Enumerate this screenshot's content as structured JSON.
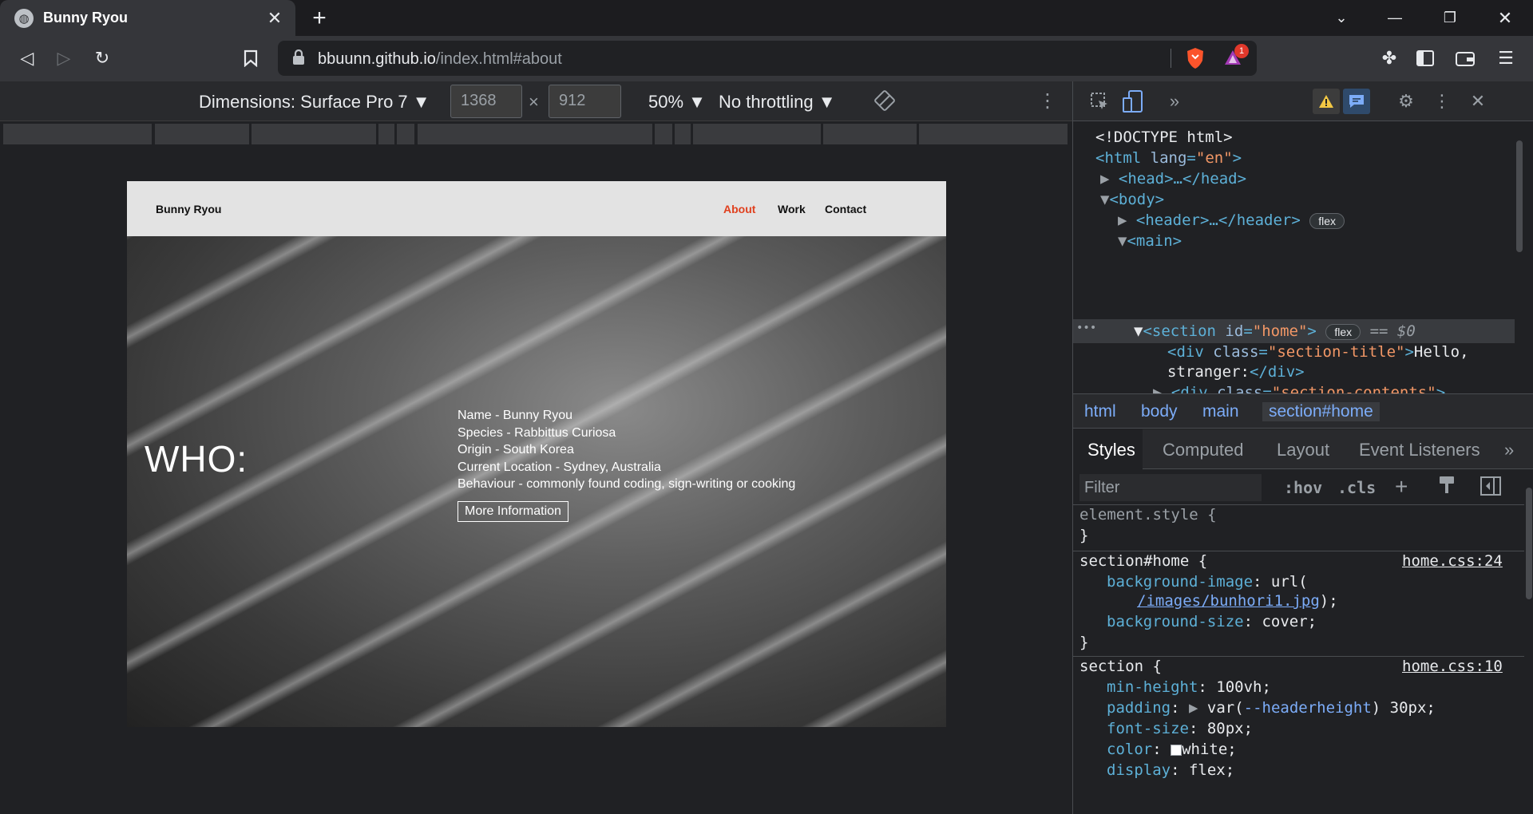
{
  "browser": {
    "tab_title": "Bunny Ryou",
    "url_host": "bbuunn.github.io",
    "url_path": "/index.html#about",
    "brave_badge": "1"
  },
  "device_toolbar": {
    "dimensions": "Dimensions: Surface Pro 7 ▼",
    "width": "1368",
    "times": "×",
    "height": "912",
    "zoom": "50% ▼",
    "throttling": "No throttling ▼"
  },
  "site": {
    "logo": "Bunny Ryou",
    "nav": [
      {
        "label": "About",
        "color": "#e0401e"
      },
      {
        "label": "Work",
        "color": "#111111"
      },
      {
        "label": "Contact",
        "color": "#111111"
      }
    ],
    "section_title": "WHO:",
    "info": [
      "Name - Bunny Ryou",
      "Species - Rabbittus Curiosa",
      "Origin - South Korea",
      "Current Location - Sydney, Australia",
      "Behaviour - commonly found coding, sign-writing or cooking"
    ],
    "more_button": "More Information"
  },
  "devtools": {
    "elements": {
      "doctype": "<!DOCTYPE html>",
      "html_open": "<html",
      "lang_attr": "lang",
      "lang_val": "\"en\"",
      "head": "<head>…</head>",
      "body": "<body>",
      "header": "<header>…</header>",
      "main": "<main>",
      "section_open": "<section",
      "id_attr": "id",
      "id_val": "\"home\"",
      "flex_badge": "flex",
      "eq_dollar": "== $0",
      "div_open": "<div",
      "class_attr": "class",
      "class_title": "\"section-title\"",
      "div_text": "Hello,",
      "div_text2": "stranger:",
      "div_close": "</div>",
      "class_contents": "\"section-contents\"",
      "ellipsis": ">…",
      "dots": "•••"
    },
    "breadcrumbs": [
      "html",
      "body",
      "main",
      "section#home"
    ],
    "style_tabs": [
      "Styles",
      "Computed",
      "Layout",
      "Event Listeners"
    ],
    "filter_placeholder": "Filter",
    "filter_buttons": [
      ":hov",
      ".cls",
      "+"
    ],
    "styles": {
      "element_style": "element.style {",
      "close": "}",
      "rule1_selector": "section#home {",
      "rule1_source": "home.css:24",
      "bg_image_prop": "background-image",
      "bg_image_url_open": "url(",
      "bg_image_url": "/images/bunhori1.jpg",
      "bg_image_url_close": ");",
      "bg_size_prop": "background-size",
      "bg_size_val": "cover;",
      "rule2_selector": "section {",
      "rule2_source": "home.css:10",
      "min_height_prop": "min-height",
      "min_height_val": "100vh;",
      "padding_prop": "padding",
      "padding_var": "var(",
      "padding_var_name": "--headerheight",
      "padding_var_rest": ") 30px;",
      "font_size_prop": "font-size",
      "font_size_val": "80px;",
      "color_prop": "color",
      "color_val": "white;",
      "display_prop": "display",
      "display_val": "flex;"
    }
  }
}
